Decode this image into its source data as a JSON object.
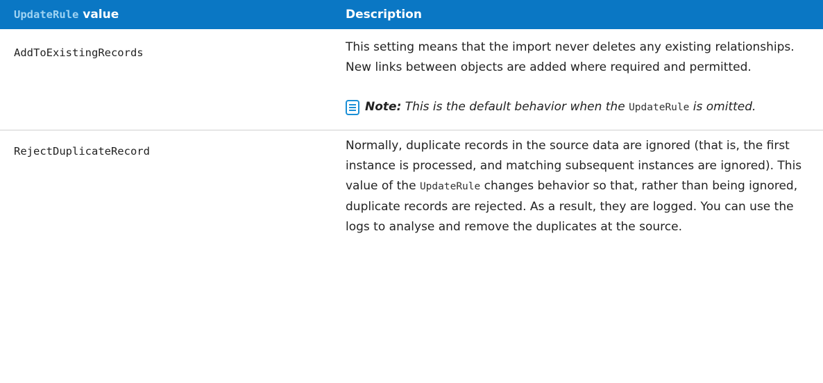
{
  "table": {
    "header": {
      "col1_code": "UpdateRule",
      "col1_suffix": " value",
      "col2": "Description"
    },
    "rows": [
      {
        "value": "AddToExistingRecords",
        "description": "This setting means that the import never deletes any existing relationships. New links between objects are added where required and permitted.",
        "note": {
          "icon": "note-icon",
          "label": "Note:",
          "before": " This is the default behavior when the ",
          "code": "UpdateRule",
          "after": " is omitted."
        }
      },
      {
        "value": "RejectDuplicateRecord",
        "description_part1": "Normally, duplicate records in the source data are ignored (that is, the first instance is processed, and matching subsequent instances are ignored). This value of the ",
        "description_code": "UpdateRule",
        "description_part2": " changes behavior so that, rather than being ignored, duplicate records are rejected. As a result, they are logged. You can use the logs to analyse and remove the duplicates at the source."
      }
    ]
  },
  "colors": {
    "header_bg": "#0a77c4",
    "header_text": "#ffffff",
    "header_code": "#9fd3f2",
    "note_icon": "#1a8fd6"
  }
}
